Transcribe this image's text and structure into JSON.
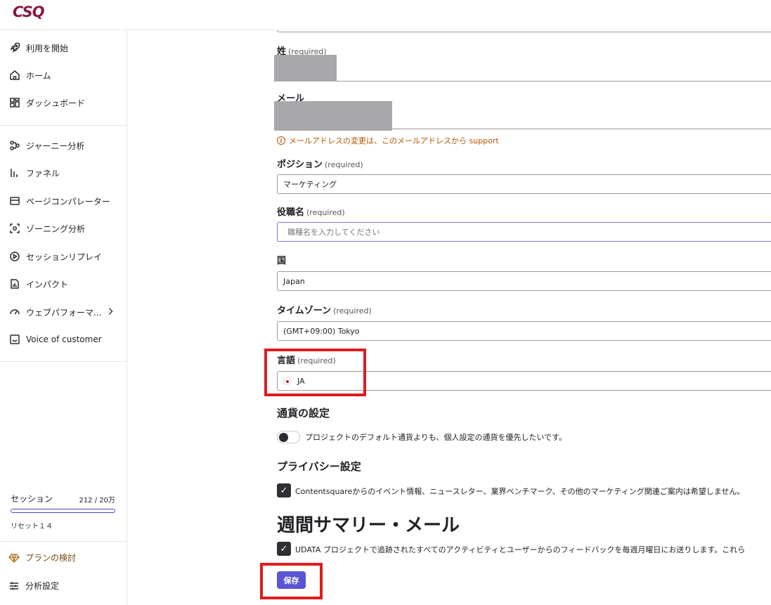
{
  "app": {
    "logo": "CSQ"
  },
  "sidebar": {
    "items": [
      {
        "label": "利用を開始",
        "icon": "rocket-icon"
      },
      {
        "label": "ホーム",
        "icon": "home-icon"
      },
      {
        "label": "ダッシュボード",
        "icon": "dashboard-icon"
      },
      {
        "label": "ジャーニー分析",
        "icon": "journey-icon"
      },
      {
        "label": "ファネル",
        "icon": "funnel-icon"
      },
      {
        "label": "ページコンパレーター",
        "icon": "page-comparator-icon"
      },
      {
        "label": "ゾーニング分析",
        "icon": "zoning-icon"
      },
      {
        "label": "セッションリプレイ",
        "icon": "play-icon"
      },
      {
        "label": "インパクト",
        "icon": "impact-icon"
      },
      {
        "label": "ウェブパフォーマ...",
        "icon": "gauge-icon"
      },
      {
        "label": "Voice of customer",
        "icon": "smile-icon"
      }
    ],
    "session": {
      "label": "セッション",
      "count": "212 / 20万",
      "usage_fraction": 0.001,
      "reset": "リセット１４"
    },
    "plan_label": "プランの検討",
    "settings_label": "分析設定"
  },
  "form": {
    "last_name": {
      "label": "姓",
      "required": "(required)"
    },
    "email": {
      "label": "メール",
      "warning": "メールアドレスの変更は、このメールアドレスから support"
    },
    "position": {
      "label": "ポジション",
      "required": "(required)",
      "value": "マーケティング"
    },
    "job_title": {
      "label": "役職名",
      "required": "(required)",
      "placeholder": "職種名を入力してください"
    },
    "country": {
      "label": "国",
      "value": "Japan"
    },
    "timezone": {
      "label": "タイムゾーン",
      "required": "(required)",
      "value": "(GMT+09:00) Tokyo"
    },
    "language": {
      "label": "言語",
      "required": "(required)",
      "value": "JA"
    }
  },
  "currency": {
    "heading": "通貨の設定",
    "toggle_label": "プロジェクトのデフォルト通貨よりも、個人設定の通貨を優先したいです。",
    "toggle_on": false
  },
  "privacy": {
    "heading": "プライバシー設定",
    "checkbox_label": "Contentsquareからのイベント情報、ニュースレター、業界ベンチマーク、その他のマーケティング関連ご案内は希望しません。",
    "checked": true
  },
  "weekly": {
    "heading": "週間サマリー・メール",
    "checkbox_label": "UDATA プロジェクトで追跡されたすべてのアクティビティとユーザーからのフィードバックを毎週月曜日にお送りします。これら",
    "checked": true
  },
  "save_label": "保存"
}
